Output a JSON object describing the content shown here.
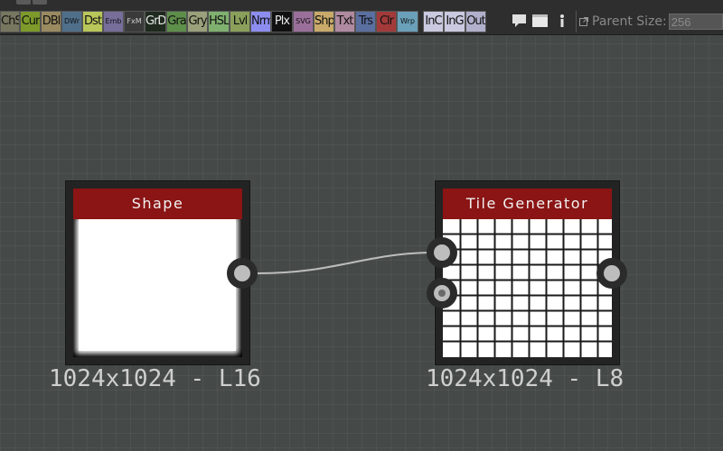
{
  "toolbar": {
    "palette": [
      {
        "label": "ChS",
        "bg": "#777760"
      },
      {
        "label": "Cur",
        "bg": "#7d9a2a"
      },
      {
        "label": "DBl",
        "bg": "#9a8a60"
      },
      {
        "label": "DWr",
        "bg": "#4f6f8a",
        "small": true
      },
      {
        "label": "Dst",
        "bg": "#b9c75a"
      },
      {
        "label": "Emb",
        "bg": "#776e9a",
        "small": true
      },
      {
        "label": "FxM",
        "bg": "#3a3a3a",
        "small": true,
        "fg": "#cfcfcf"
      },
      {
        "label": "GrD",
        "bg": "#1e2a1e",
        "fg": "#e8e8e8"
      },
      {
        "label": "Gra",
        "bg": "#5e8f4a"
      },
      {
        "label": "Gry",
        "bg": "#9aa07a"
      },
      {
        "label": "HSL",
        "bg": "#7fb06f"
      },
      {
        "label": "Lvl",
        "bg": "#8aa05a"
      },
      {
        "label": "Nrm",
        "bg": "#8d8df0"
      },
      {
        "label": "Plx",
        "bg": "#111111",
        "fg": "#e8e8e8"
      },
      {
        "label": "SVG",
        "bg": "#9a6f9a",
        "small": true
      },
      {
        "label": "Shp",
        "bg": "#c9aa6a"
      },
      {
        "label": "Txt",
        "bg": "#b08aa0"
      },
      {
        "label": "Trs",
        "bg": "#5a6fa0"
      },
      {
        "label": "Clr",
        "bg": "#a23a3a"
      },
      {
        "label": "Wrp",
        "bg": "#6aa0b9",
        "small": true
      },
      {
        "label": "InC",
        "bg": "#c9c9e0"
      },
      {
        "label": "InG",
        "bg": "#c9c9e0"
      },
      {
        "label": "Out",
        "bg": "#b0b0cc"
      }
    ],
    "icons": [
      "comment-icon",
      "frame-icon",
      "pin-icon"
    ],
    "parent_size": {
      "label": "Parent Size:",
      "value": "256",
      "icon": "popout-icon"
    }
  },
  "nodes": [
    {
      "id": "shape",
      "title": "Shape",
      "size_label": "1024x1024 - L16",
      "preview": "white-square",
      "outputs": 1
    },
    {
      "id": "tile-generator",
      "title": "Tile Generator",
      "size_label": "1024x1024 - L8",
      "preview": "white-grid",
      "inputs": 2,
      "outputs": 1
    }
  ],
  "connection": {
    "from": "shape.output",
    "to": "tile-generator.input.0",
    "color": "#bdbdbd"
  },
  "colors": {
    "title_bar": "#8b1414",
    "canvas": "#454a48"
  }
}
